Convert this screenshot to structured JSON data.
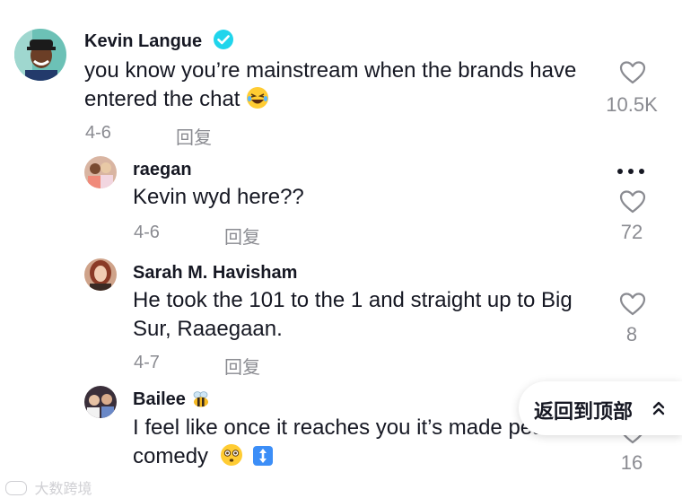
{
  "comments": [
    {
      "author": "Kevin Langue",
      "verified": true,
      "line1": "you know you’re mainstream when the brands have",
      "line2": "entered the chat",
      "emoji": "laughing-emoji",
      "date": "4-6",
      "reply": "回复",
      "likes": "10.5K"
    }
  ],
  "replies": [
    {
      "author": "raegan",
      "text": "Kevin wyd here??",
      "date": "4-6",
      "reply": "回复",
      "likes": "72"
    },
    {
      "author": "Sarah M. Havisham",
      "line1": "He took the 101 to the 1 and straight up to Big",
      "line2": "Sur, Raaegaan.",
      "date": "4-7",
      "reply": "回复",
      "likes": "8"
    },
    {
      "author": "Bailee",
      "author_emoji": "bee-emoji",
      "line1": "I feel like once it reaches you it’s made peak",
      "line2": "comedy",
      "likes": "16"
    }
  ],
  "back_to_top": "返回到顶部",
  "watermark": "大数跨境",
  "colors": {
    "text": "#161823",
    "muted": "#8a8b91",
    "verified": "#20d5ec"
  },
  "icons": [
    "heart-icon",
    "verified-badge-icon",
    "more-icon",
    "chevron-up-icon"
  ]
}
